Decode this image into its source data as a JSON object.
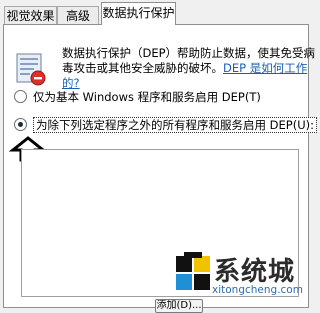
{
  "tabs": [
    {
      "label": "视觉效果"
    },
    {
      "label": "高级"
    },
    {
      "label": "数据执行保护"
    }
  ],
  "description": {
    "line1": "数据执行保护（DEP）帮助防止数据，使其免受病",
    "line2": "毒攻击或其他安全威胁的破坏。",
    "link_part1": "DEP 是如何工作",
    "link_part2": "的?"
  },
  "options": [
    {
      "label": "仅为基本 Windows 程序和服务启用 DEP(T)",
      "checked": false
    },
    {
      "label": "为除下列选定程序之外的所有程序和服务启用 DEP(U):",
      "checked": true
    }
  ],
  "add_button_label": "添加(D)...",
  "watermark": {
    "name": "系统城",
    "url": "xitongcheng.com"
  },
  "icons": {
    "shield": "dep-shield-icon",
    "arrow": "up-arrow-annotation-icon",
    "watermark": "xitongcheng-logo-icon"
  }
}
